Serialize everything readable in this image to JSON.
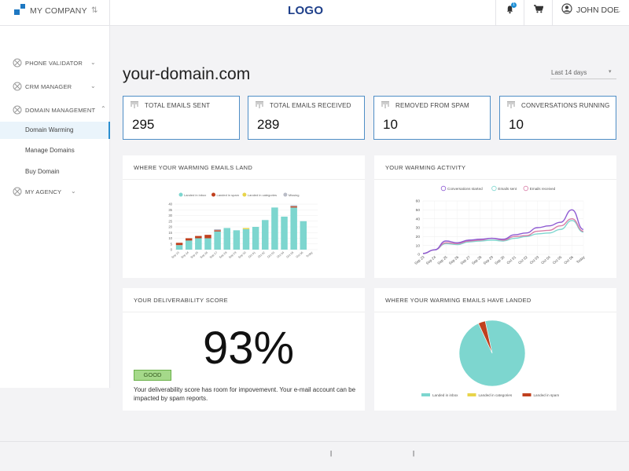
{
  "header": {
    "company_name": "MY COMPANY",
    "logo": "LOGO",
    "notification_count": "1",
    "user_name": "JOHN DOE",
    "icons": [
      "company-logo-icon",
      "switch-icon",
      "bell-icon",
      "cart-icon",
      "user-avatar-icon",
      "chevron-down-icon"
    ]
  },
  "sidebar": {
    "items": [
      {
        "label": "PHONE VALIDATOR"
      },
      {
        "label": "CRM MANAGER"
      },
      {
        "label": "DOMAIN MANAGEMENT"
      },
      {
        "label": "MY AGENCY"
      }
    ],
    "subitems": [
      {
        "label": "Domain Warming",
        "active": true
      },
      {
        "label": "Manage Domains"
      },
      {
        "label": "Buy Domain"
      }
    ]
  },
  "main": {
    "title": "your-domain.com",
    "date_range": "Last 14 days"
  },
  "stats": [
    {
      "label": "TOTAL EMAILS SENT",
      "value": "295"
    },
    {
      "label": "TOTAL EMAILS RECEIVED",
      "value": "289"
    },
    {
      "label": "REMOVED FROM SPAM",
      "value": "10"
    },
    {
      "label": "CONVERSATIONS RUNNING",
      "value": "10"
    }
  ],
  "panels": {
    "land_title": "WHERE YOUR WARMING EMAILS LAND",
    "activity_title": "YOUR WARMING ACTIVITY",
    "score_title": "YOUR DELIVERABILITY SCORE",
    "landed_title": "WHERE YOUR WARMING EMAILS HAVE LANDED",
    "score_value": "93%",
    "score_badge": "GOOD",
    "score_text": "Your deliverability score has room for impovemevnt. Your e-mail account can be impacted by spam reports."
  },
  "colors": {
    "inbox": "#7dd6cf",
    "spam": "#c0401e",
    "categories": "#e8d44a",
    "missing": "#b9bcc6",
    "conversations": "#8e5ad2",
    "sent": "#7dd6cf",
    "received": "#d97fa8",
    "accent": "#2a8ed0"
  },
  "chart_data": [
    {
      "type": "bar",
      "title": "WHERE YOUR WARMING EMAILS LAND",
      "categories": [
        "Sep 23",
        "Sep 24",
        "Sep 25",
        "Sep 26",
        "Sep 27",
        "Sep 28",
        "Sep 29",
        "Sep 30",
        "Oct 01",
        "Oct 02",
        "Oct 03",
        "Oct 04",
        "Oct 05",
        "Oct 06",
        "Today"
      ],
      "ylim": [
        0,
        40
      ],
      "yticks": [
        0,
        5,
        10,
        15,
        20,
        25,
        30,
        35,
        40
      ],
      "legend": "top",
      "series": [
        {
          "name": "Landed in inbox",
          "values": [
            4,
            8,
            10,
            10,
            16,
            19,
            17,
            18,
            20,
            26,
            37,
            29,
            37,
            25,
            0
          ]
        },
        {
          "name": "Landed in spam",
          "values": [
            2,
            2,
            2,
            3,
            1,
            0,
            0,
            0,
            0,
            0,
            0,
            0,
            1,
            0,
            0
          ]
        },
        {
          "name": "Landed in categories",
          "values": [
            0,
            0,
            0,
            0,
            0,
            0,
            0,
            1,
            0,
            0,
            0,
            0,
            0,
            0,
            0
          ]
        },
        {
          "name": "Missing",
          "values": [
            0,
            0,
            0,
            0,
            1,
            0,
            0,
            0,
            0,
            0,
            0,
            0,
            1,
            0,
            0
          ]
        }
      ]
    },
    {
      "type": "line",
      "title": "YOUR WARMING ACTIVITY",
      "categories": [
        "Sep 23",
        "Sep 24",
        "Sep 25",
        "Sep 26",
        "Sep 27",
        "Sep 28",
        "Sep 29",
        "Sep 30",
        "Oct 01",
        "Oct 02",
        "Oct 03",
        "Oct 04",
        "Oct 05",
        "Oct 06",
        "Today"
      ],
      "ylim": [
        0,
        60
      ],
      "yticks": [
        0,
        10,
        20,
        30,
        40,
        50,
        60
      ],
      "legend": "top",
      "series": [
        {
          "name": "Conversations started",
          "values": [
            1,
            5,
            15,
            13,
            16,
            17,
            18,
            17,
            22,
            24,
            30,
            32,
            36,
            50,
            28
          ]
        },
        {
          "name": "Emails sent",
          "values": [
            1,
            5,
            12,
            11,
            14,
            15,
            16,
            15,
            18,
            20,
            23,
            24,
            28,
            38,
            25
          ]
        },
        {
          "name": "Emails received",
          "values": [
            1,
            5,
            13,
            12,
            15,
            16,
            18,
            16,
            20,
            21,
            26,
            27,
            32,
            40,
            26
          ]
        }
      ]
    },
    {
      "type": "pie",
      "title": "WHERE YOUR WARMING EMAILS HAVE LANDED",
      "legend": "bottom",
      "categories": [
        "Landed in inbox",
        "Landed in categories",
        "Landed in spam"
      ],
      "values": [
        282,
        0,
        10
      ]
    }
  ]
}
